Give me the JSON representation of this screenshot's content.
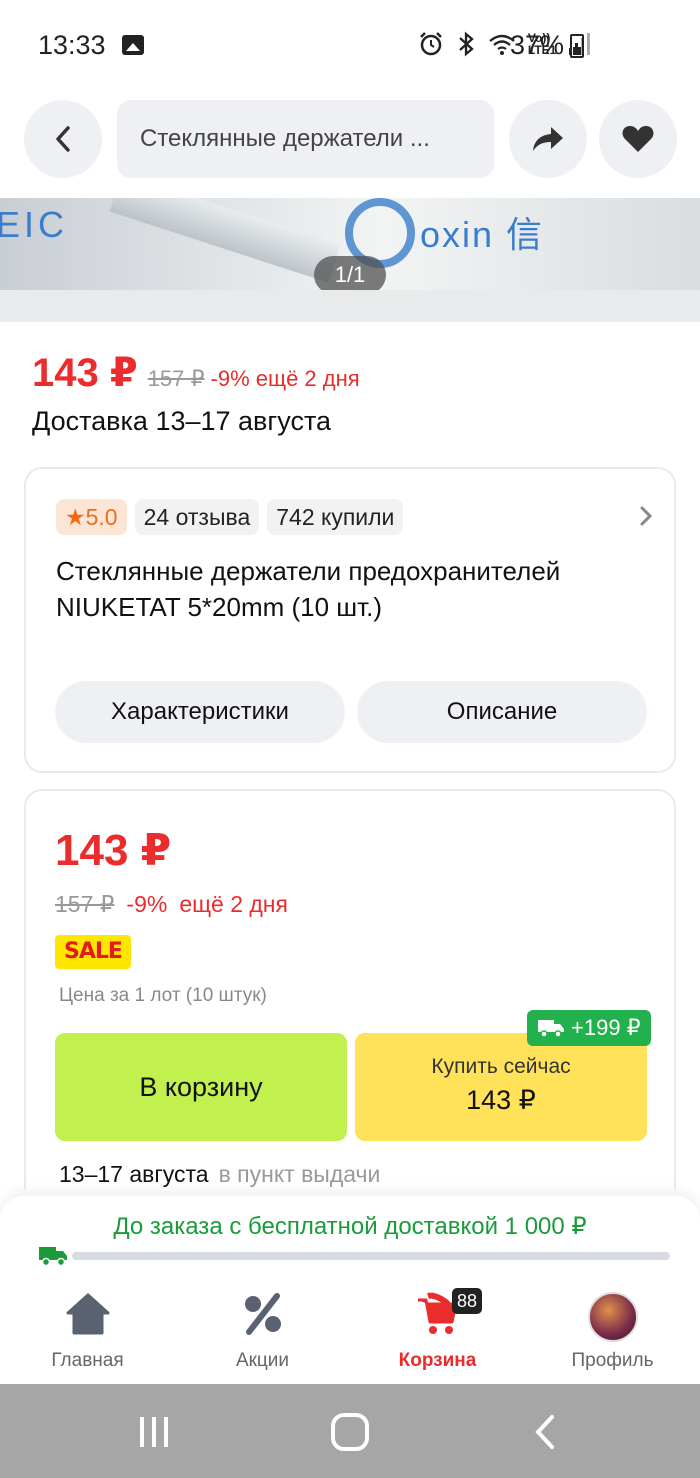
{
  "status_bar": {
    "time": "13:33",
    "battery": "37%",
    "icons": [
      "alarm-icon",
      "bluetooth-icon",
      "wifi-icon",
      "lte-icon",
      "signal-icon"
    ],
    "volte_label": "Vo)) LTE1"
  },
  "top_bar": {
    "search_text": "Стеклянные держатели ..."
  },
  "gallery": {
    "counter": "1/1"
  },
  "summary": {
    "price": "143 ₽",
    "old_price": "157 ₽",
    "discount": "-9% ещё 2 дня",
    "delivery": "Доставка 13–17 августа"
  },
  "info": {
    "rating": "5.0",
    "reviews": "24 отзыва",
    "bought": "742 купили",
    "title": "Стеклянные держатели предохранителей NIUKETAT 5*20mm (10 шт.)",
    "specs_label": "Характеристики",
    "description_label": "Описание"
  },
  "offer": {
    "price": "143 ₽",
    "old_price": "157 ₽",
    "discount": "-9%",
    "days_left": "ещё 2 дня",
    "sale_badge": "SALE",
    "lot_note": "Цена за 1 лот (10 штук)",
    "shipping_badge": "+199 ₽",
    "cart_label": "В корзину",
    "buy_label": "Купить сейчас",
    "buy_price": "143 ₽",
    "pickup_date": "13–17 августа",
    "pickup_place": "в пункт выдачи"
  },
  "free_shipping": {
    "text": "До заказа с бесплатной доставкой 1 000 ₽",
    "progress": 0.0
  },
  "bottom_nav": {
    "items": [
      {
        "label": "Главная",
        "icon": "home-icon"
      },
      {
        "label": "Акции",
        "icon": "percent-icon"
      },
      {
        "label": "Корзина",
        "icon": "cart-icon",
        "active": true
      },
      {
        "label": "Профиль",
        "icon": "avatar"
      }
    ],
    "cart_count": "88"
  },
  "colors": {
    "accent_red": "#ea2c2c",
    "cart_green": "#c2f04e",
    "buy_yellow": "#ffe15a",
    "ship_green": "#22b14c"
  }
}
